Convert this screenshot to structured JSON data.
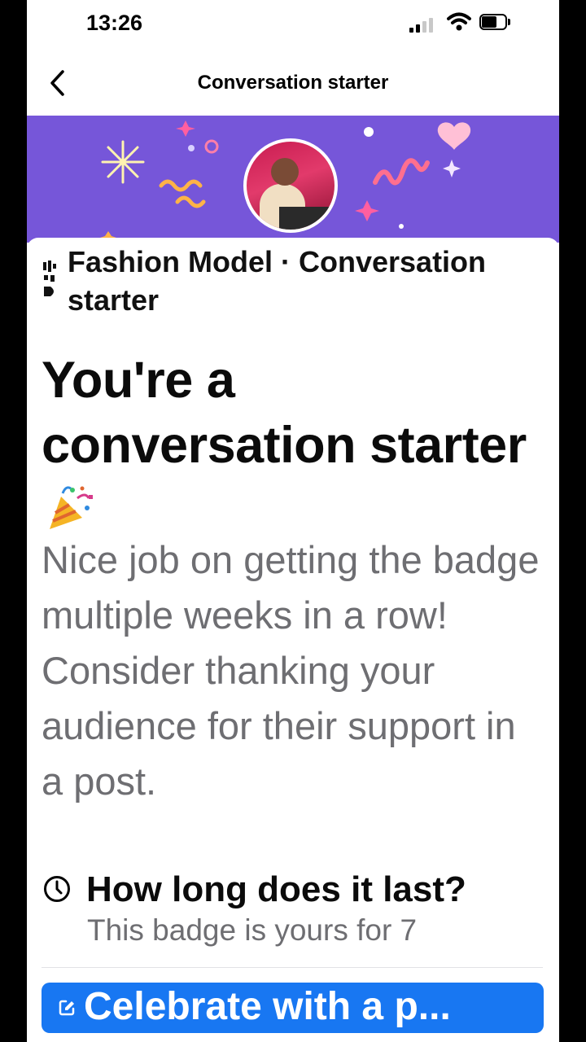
{
  "status_bar": {
    "time": "13:26"
  },
  "header": {
    "title": "Conversation starter"
  },
  "badge": {
    "channel_line": "Fashion Model · Conversation starter",
    "headline": "You're a conversation starter",
    "description": "Nice job on getting the badge multiple weeks in a row! Consider thanking your audience for their support in a post.",
    "duration_question": "How long does it last?",
    "duration_answer": "This badge is yours for 7"
  },
  "cta": {
    "label": "Celebrate with a p..."
  },
  "colors": {
    "banner": "#7656d9",
    "cta": "#1877f2"
  },
  "icons": [
    "back-chevron-icon",
    "signal-icon",
    "wifi-icon",
    "battery-icon",
    "party-popper-icon",
    "clock-icon",
    "edit-icon"
  ]
}
